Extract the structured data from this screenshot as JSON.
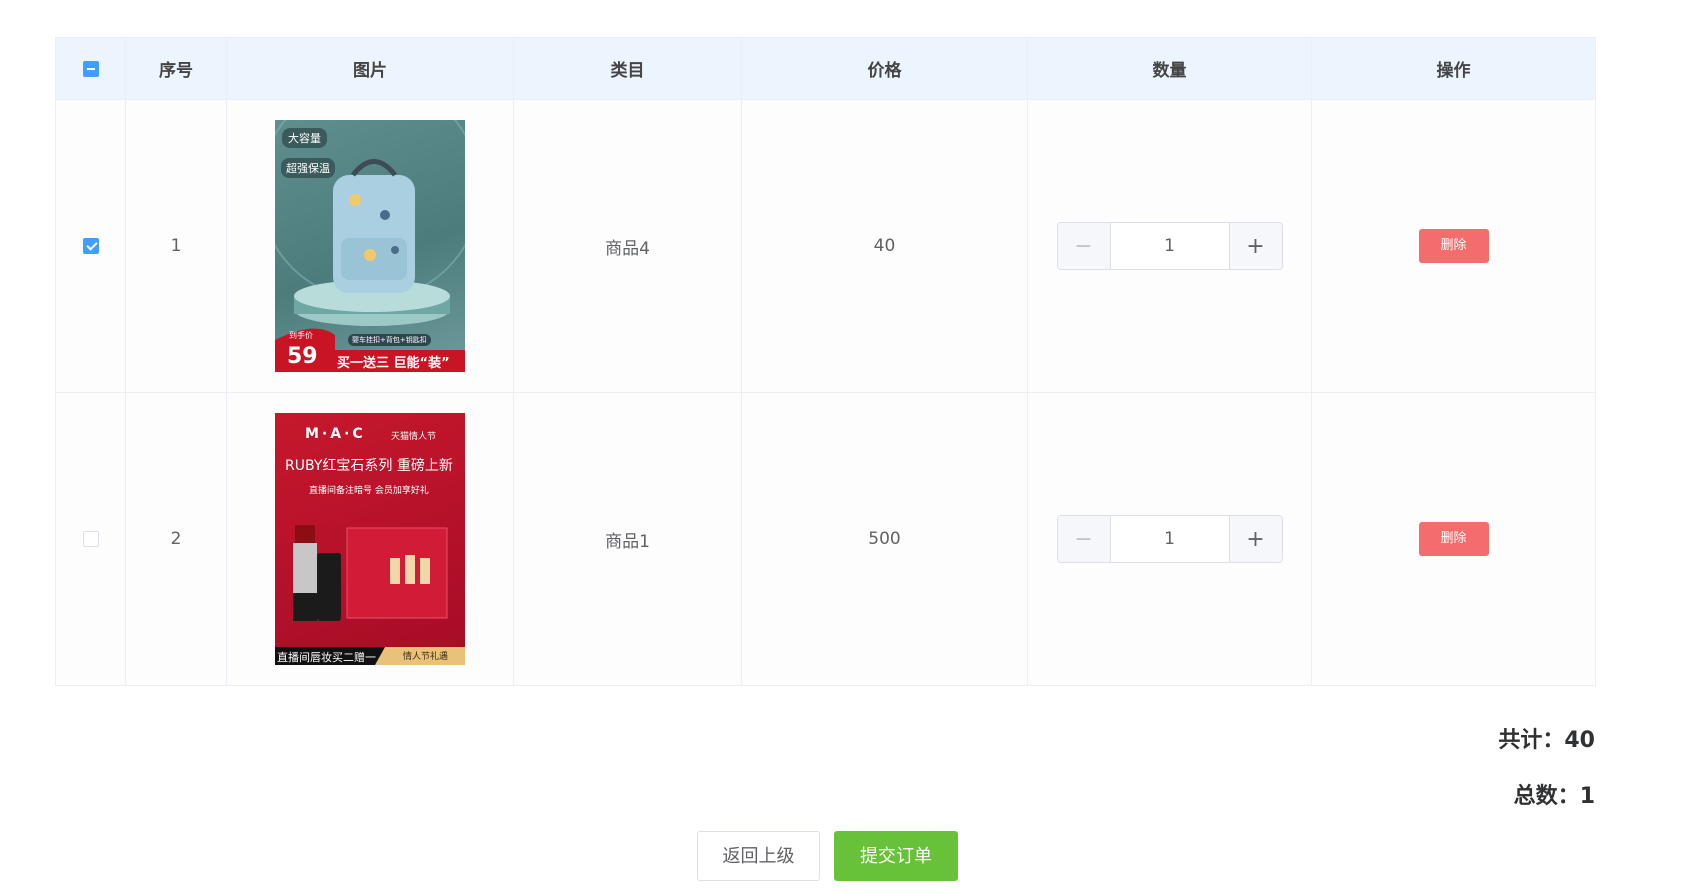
{
  "table": {
    "headers": {
      "index": "序号",
      "image": "图片",
      "category": "类目",
      "price": "价格",
      "quantity": "数量",
      "actions": "操作"
    },
    "select_all_state": "indeterminate",
    "rows": [
      {
        "checked": true,
        "index": "1",
        "category": "商品4",
        "price": "40",
        "quantity": "1",
        "delete_label": "删除",
        "image": {
          "badge1": "大容量",
          "badge2": "超强保温",
          "price_tag": "到手价",
          "price_value": "59",
          "promo": "买一送三 巨能“装”",
          "feature": "婴车挂扣+背包+钥匙扣"
        }
      },
      {
        "checked": false,
        "index": "2",
        "category": "商品1",
        "price": "500",
        "quantity": "1",
        "delete_label": "删除",
        "image": {
          "brand": "M·A·C",
          "event": "天猫情人节",
          "headline": "RUBY红宝石系列 重磅上新",
          "sub": "直播间备注暗号 会员加享好礼",
          "footer_left": "直播间唇妆买二赠一",
          "footer_right": "情人节礼遇"
        }
      }
    ]
  },
  "summary": {
    "total_label": "共计：",
    "total_value": "40",
    "count_label": "总数：",
    "count_value": "1"
  },
  "buttons": {
    "back": "返回上级",
    "submit": "提交订单"
  },
  "colors": {
    "header_bg": "#ecf5fd",
    "delete": "#f56c6c",
    "submit": "#67c23a",
    "checkbox": "#409eff"
  }
}
